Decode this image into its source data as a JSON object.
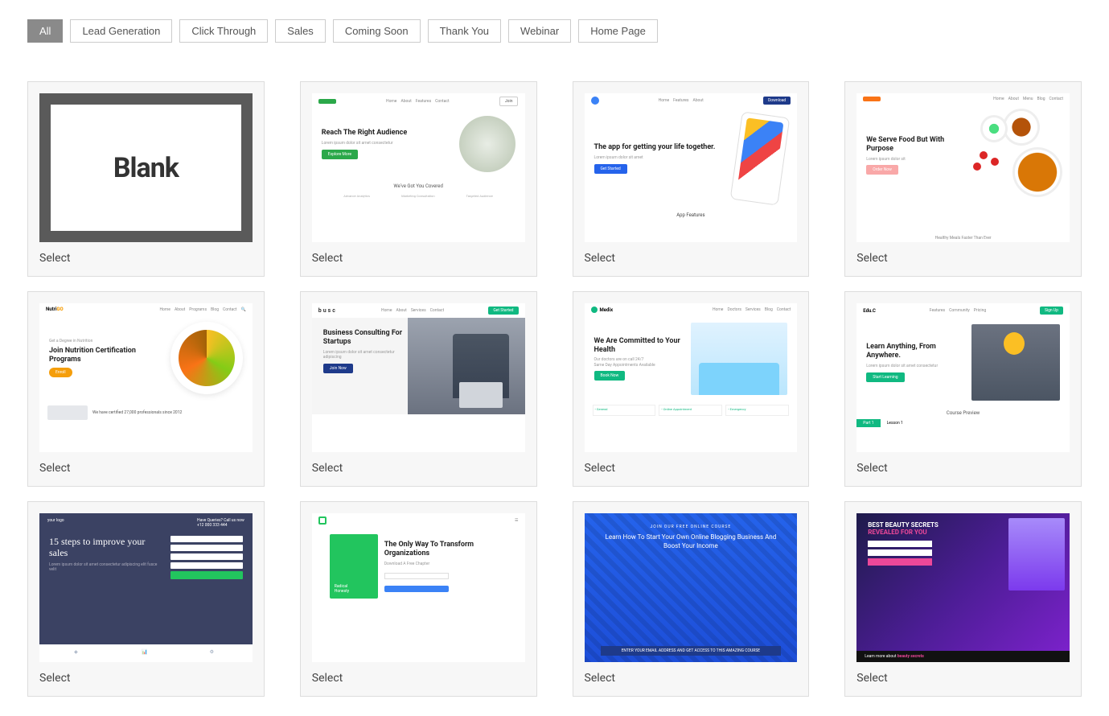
{
  "filters": [
    {
      "label": "All",
      "active": true
    },
    {
      "label": "Lead Generation",
      "active": false
    },
    {
      "label": "Click Through",
      "active": false
    },
    {
      "label": "Sales",
      "active": false
    },
    {
      "label": "Coming Soon",
      "active": false
    },
    {
      "label": "Thank You",
      "active": false
    },
    {
      "label": "Webinar",
      "active": false
    },
    {
      "label": "Home Page",
      "active": false
    }
  ],
  "select_label": "Select",
  "templates": {
    "blank": {
      "title": "Blank"
    },
    "t2": {
      "headline": "Reach The Right Audience",
      "sub": "We've Got You Covered",
      "btn": "Explore More",
      "col1": "Advance Analytics",
      "col2": "Marketing Consultation",
      "col3": "Targeted Audience"
    },
    "t3": {
      "headline": "The app for getting your life together.",
      "btn": "Get Started",
      "feat": "App Features"
    },
    "t4": {
      "headline": "We Serve Food But With Purpose",
      "btn": "Order Now",
      "strip": "Healthy Meals Faster Than Ever"
    },
    "t5": {
      "logo": "NutriGO",
      "pre": "Get a Degree in Nutrition",
      "headline": "Join Nutrition Certification Programs",
      "cert": "We have certified 27,000 professionals since 2012"
    },
    "t6": {
      "logo": "busc",
      "headline": "Business Consulting For Startups",
      "btn": "Join Now"
    },
    "t7": {
      "logo": "Medix",
      "headline": "We Are Committed to Your Health",
      "btn": "Book Now"
    },
    "t8": {
      "logo": "Edu.C",
      "headline": "Learn Anything, From Anywhere.",
      "btn": "Start Learning",
      "prev": "Course Preview",
      "tab1": "Part 1",
      "tab2": "Lesson 1"
    },
    "t9": {
      "logo": "your logo",
      "phone": "Have Queries? Call us now",
      "num": "+12 000 333 444",
      "headline": "15 steps to improve your sales"
    },
    "t10": {
      "book1": "Radical",
      "book2": "Honesty",
      "headline": "The Only Way To Transform Organizations",
      "sub": "Download A Free Chapter"
    },
    "t11": {
      "pre": "JOIN OUR FREE ONLINE COURSE",
      "headline": "Learn How To Start Your Own Online Blogging Business And Boost Your Income",
      "bar": "ENTER YOUR EMAIL ADDRESS AND GET ACCESS TO THIS AMAZING COURSE"
    },
    "t12": {
      "h1": "BEST BEAUTY SECRETS",
      "h2": "REVEALED FOR YOU",
      "low": "Learn more about",
      "low2": "beauty secrets"
    }
  }
}
